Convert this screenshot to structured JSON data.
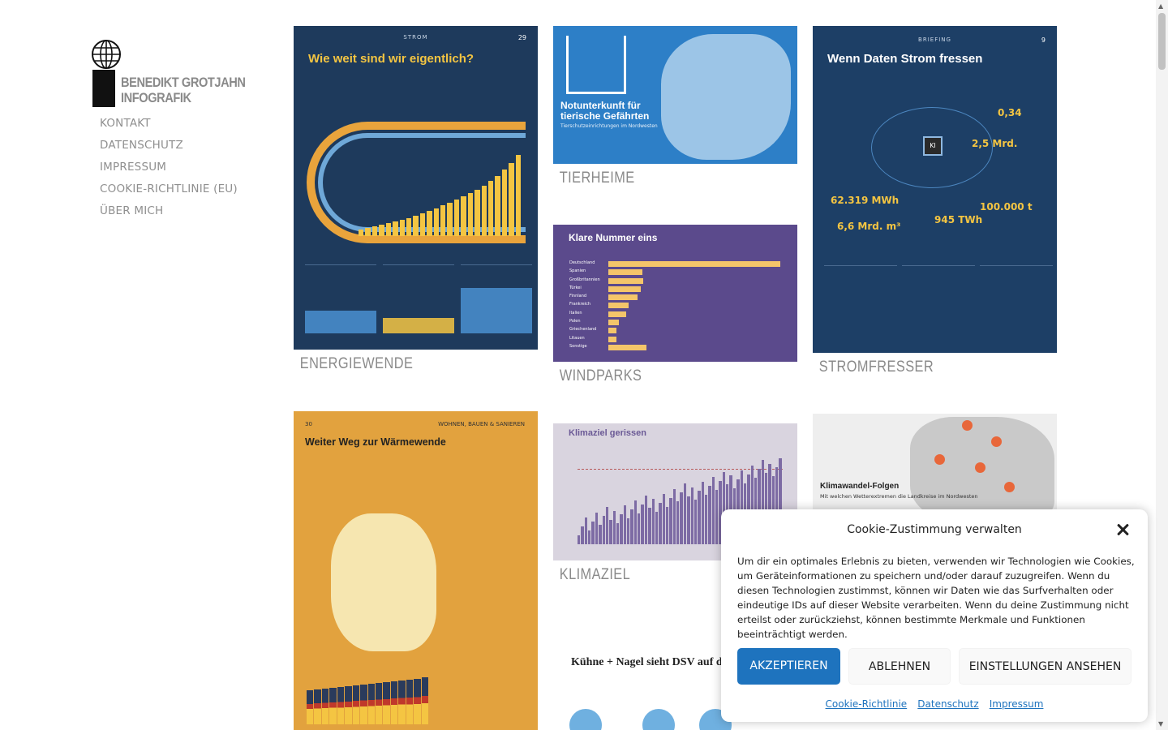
{
  "site": {
    "logo_text_line1": "BENEDIKT GROTJAHN",
    "logo_text_line2": "INFOGRAFIK"
  },
  "nav": {
    "items": [
      {
        "label": "KONTAKT"
      },
      {
        "label": "DATENSCHUTZ"
      },
      {
        "label": "IMPRESSUM"
      },
      {
        "label": "COOKIE-RICHTLINIE (EU)"
      },
      {
        "label": "ÜBER MICH"
      }
    ]
  },
  "tiles": {
    "energiewende": {
      "caption": "ENERGIEWENDE",
      "section": "STROM",
      "page": "29",
      "title": "Wie weit sind wir eigentlich?"
    },
    "tierheime": {
      "caption": "TIERHEIME",
      "title": "Notunterkunft für tierische Gefährten",
      "subtitle": "Tierschutzeinrichtungen im Nordwesten"
    },
    "windparks": {
      "caption": "WINDPARKS",
      "title": "Klare Nummer eins",
      "countries": [
        "Deutschland",
        "Spanien",
        "Großbritannien",
        "Türkei",
        "Finnland",
        "Frankreich",
        "Italien",
        "Polen",
        "Griechenland",
        "Litauen",
        "Sonstige"
      ],
      "values": [
        3166,
        630,
        645,
        595,
        543,
        380,
        323,
        196,
        153,
        148,
        697
      ]
    },
    "stromfresser": {
      "caption": "STROMFRESSER",
      "section": "BRIEFING",
      "page": "9",
      "title": "Wenn Daten Strom fressen",
      "chip_label": "KI",
      "stat1": "62.319 MWh",
      "stat2": "945 TWh",
      "stat3": "100.000 t",
      "stat4": "6,6 Mrd. m³",
      "stat5": "2,5 Mrd.",
      "stat6": "0,34"
    },
    "waermewende": {
      "page": "30",
      "section": "WOHNEN, BAUEN & SANIEREN",
      "title": "Weiter Weg zur Wärmewende"
    },
    "klimaziel": {
      "caption": "KLIMAZIEL",
      "title": "Klimaziel gerissen"
    },
    "klimawandel": {
      "title": "Klimawandel-Folgen",
      "subtitle": "Mit welchen Wetterextremen die Landkreise im Nordwesten"
    },
    "kuehne": {
      "title": "Kühne + Nagel sieht DSV auf der Überholspur"
    }
  },
  "cookie": {
    "title": "Cookie-Zustimmung verwalten",
    "text": "Um dir ein optimales Erlebnis zu bieten, verwenden wir Technologien wie Cookies, um Geräteinformationen zu speichern und/oder darauf zuzugreifen. Wenn du diesen Technologien zustimmst, können wir Daten wie das Surfverhalten oder eindeutige IDs auf dieser Website verarbeiten. Wenn du deine Zustimmung nicht erteilst oder zurückziehst, können bestimmte Merkmale und Funktionen beeinträchtigt werden.",
    "accept_label": "AKZEPTIEREN",
    "deny_label": "ABLEHNEN",
    "settings_label": "EINSTELLUNGEN ANSEHEN",
    "links": [
      {
        "label": "Cookie-Richtlinie"
      },
      {
        "label": "Datenschutz"
      },
      {
        "label": "Impressum"
      }
    ],
    "accent_color": "#1e73be"
  }
}
